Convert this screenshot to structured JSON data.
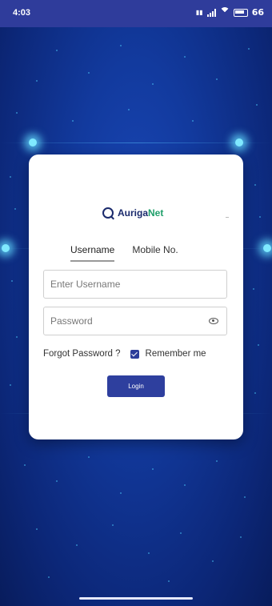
{
  "status_bar": {
    "time": "4:03",
    "battery": "66"
  },
  "brand": {
    "name_part1": "Auriga",
    "name_part2": "Net"
  },
  "tabs": [
    {
      "label": "Username"
    },
    {
      "label": "Mobile No."
    }
  ],
  "form": {
    "username_placeholder": "Enter Username",
    "password_placeholder": "Password",
    "forgot_password": "Forgot Password ?",
    "remember_me": "Remember me",
    "login_button": "Login"
  }
}
